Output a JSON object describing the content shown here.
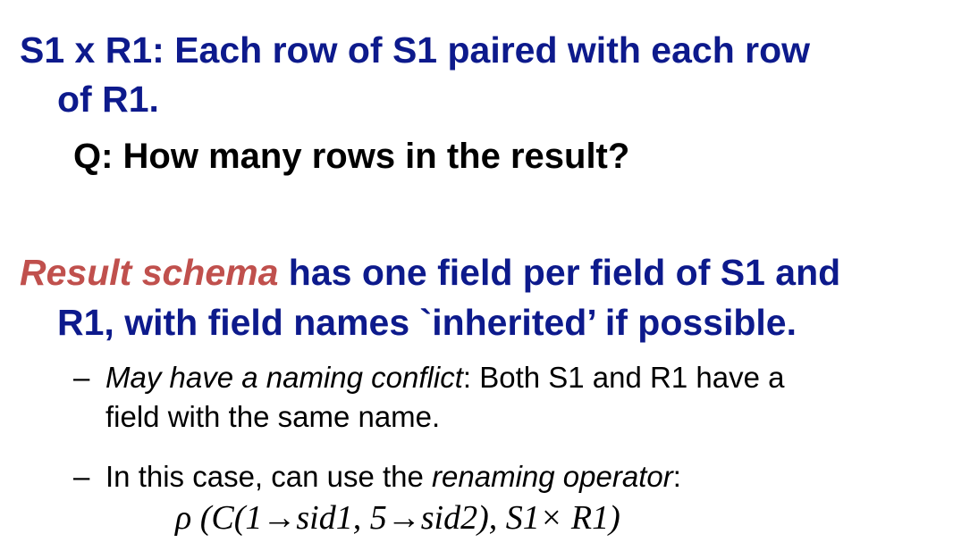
{
  "heading1": {
    "line1": "S1 x R1: Each row of S1 paired with each row",
    "line2": "of R1."
  },
  "question": "Q: How many rows in the result?",
  "heading2": {
    "emphasis": "Result schema",
    "line1_rest": " has one field per field of S1 and",
    "line2": "R1, with field names `inherited’ if possible."
  },
  "bullets": [
    {
      "dash": "–",
      "italic": "May have a naming conflict",
      "rest_line1": ":  Both S1 and R1 have a",
      "line2": "field with the same name."
    },
    {
      "dash": "–",
      "prefix": "In this case, can use the ",
      "italic": "renaming operator",
      "suffix": ":"
    }
  ],
  "formula": "ρ (C(1→sid1, 5→sid2), S1× R1)"
}
